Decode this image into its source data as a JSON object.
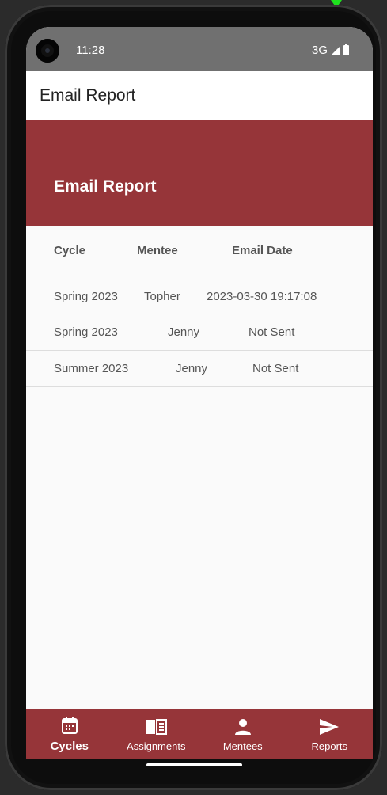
{
  "status": {
    "time": "11:28",
    "network": "3G"
  },
  "appbar": {
    "title": "Email Report"
  },
  "banner": {
    "title": "Email Report"
  },
  "table": {
    "headers": [
      "Cycle",
      "Mentee",
      "Email Date"
    ],
    "rows": [
      [
        "Spring 2023",
        "Topher",
        "2023-03-30 19:17:08"
      ],
      [
        "Spring 2023",
        "Jenny",
        "Not Sent"
      ],
      [
        "Summer 2023",
        "Jenny",
        "Not Sent"
      ]
    ]
  },
  "nav": {
    "items": [
      {
        "label": "Cycles",
        "icon": "calendar-icon",
        "active": true
      },
      {
        "label": "Assignments",
        "icon": "book-icon",
        "active": false
      },
      {
        "label": "Mentees",
        "icon": "person-icon",
        "active": false
      },
      {
        "label": "Reports",
        "icon": "send-icon",
        "active": false
      }
    ]
  },
  "colors": {
    "accent": "#963539",
    "statusbar": "#707070"
  }
}
